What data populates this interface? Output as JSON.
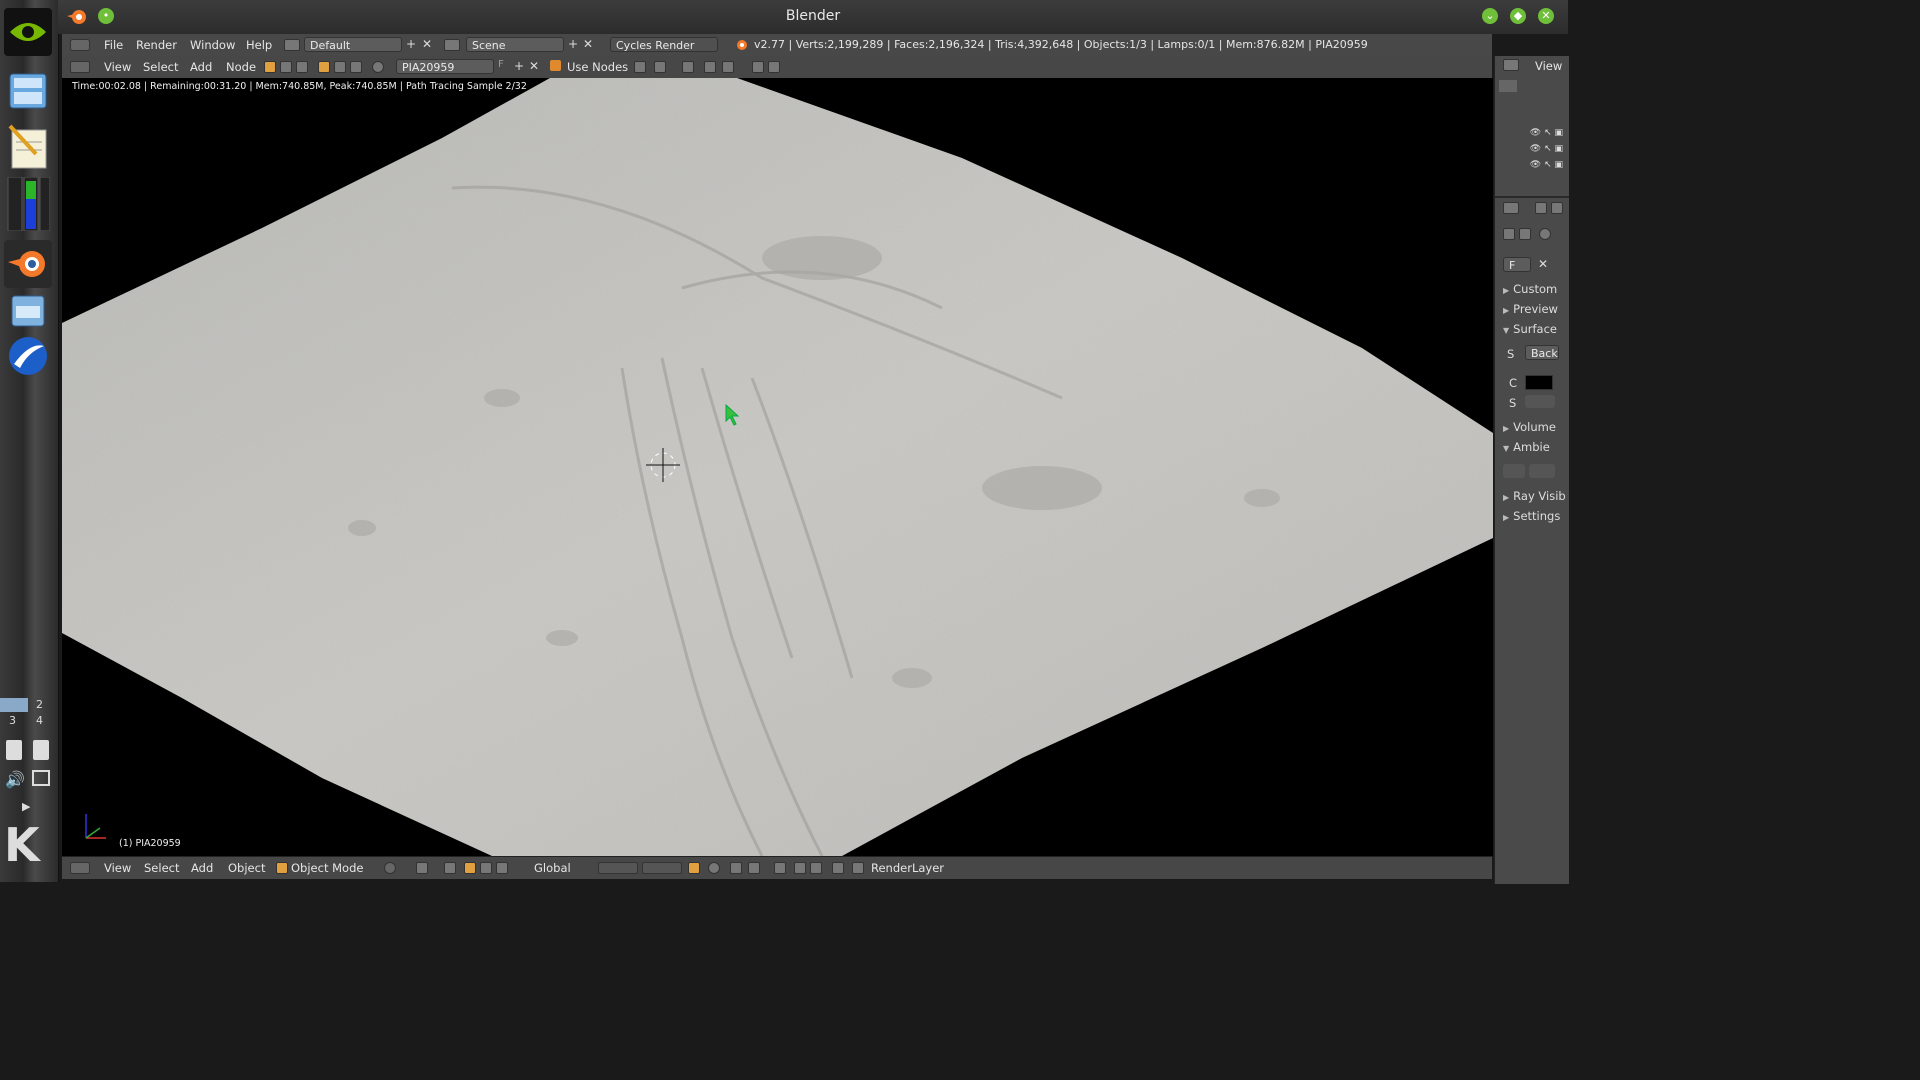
{
  "window": {
    "title": "Blender"
  },
  "info_header": {
    "menus": [
      "File",
      "Render",
      "Window",
      "Help"
    ],
    "layout": "Default",
    "scene": "Scene",
    "engine": "Cycles Render",
    "stats": "v2.77 | Verts:2,199,289 | Faces:2,196,324 | Tris:4,392,648 | Objects:1/3 | Lamps:0/1 | Mem:876.82M | PIA20959"
  },
  "node_header": {
    "menus": [
      "View",
      "Select",
      "Add",
      "Node"
    ],
    "material": "PIA20959",
    "fake_user": "F",
    "use_nodes_label": "Use Nodes"
  },
  "viewport": {
    "render_status": "Time:00:02.08 | Remaining:00:31.20 | Mem:740.85M, Peak:740.85M | Path Tracing Sample 2/32",
    "object_label": "(1) PIA20959"
  },
  "bottom_header": {
    "menus": [
      "View",
      "Select",
      "Add",
      "Object"
    ],
    "mode": "Object Mode",
    "orientation": "Global",
    "render_layer": "RenderLayer"
  },
  "outliner": {
    "view_label": "View"
  },
  "properties": {
    "panels": [
      "Custom",
      "Preview",
      "Surface",
      "Volume",
      "Ambie",
      "Ray Visib",
      "Settings"
    ],
    "surface_s": "S",
    "surface_back": "Back",
    "row_c": "C",
    "row_s": "S",
    "mat_field": "F"
  },
  "dock": {
    "desktops": [
      "2",
      "3",
      "4"
    ]
  }
}
